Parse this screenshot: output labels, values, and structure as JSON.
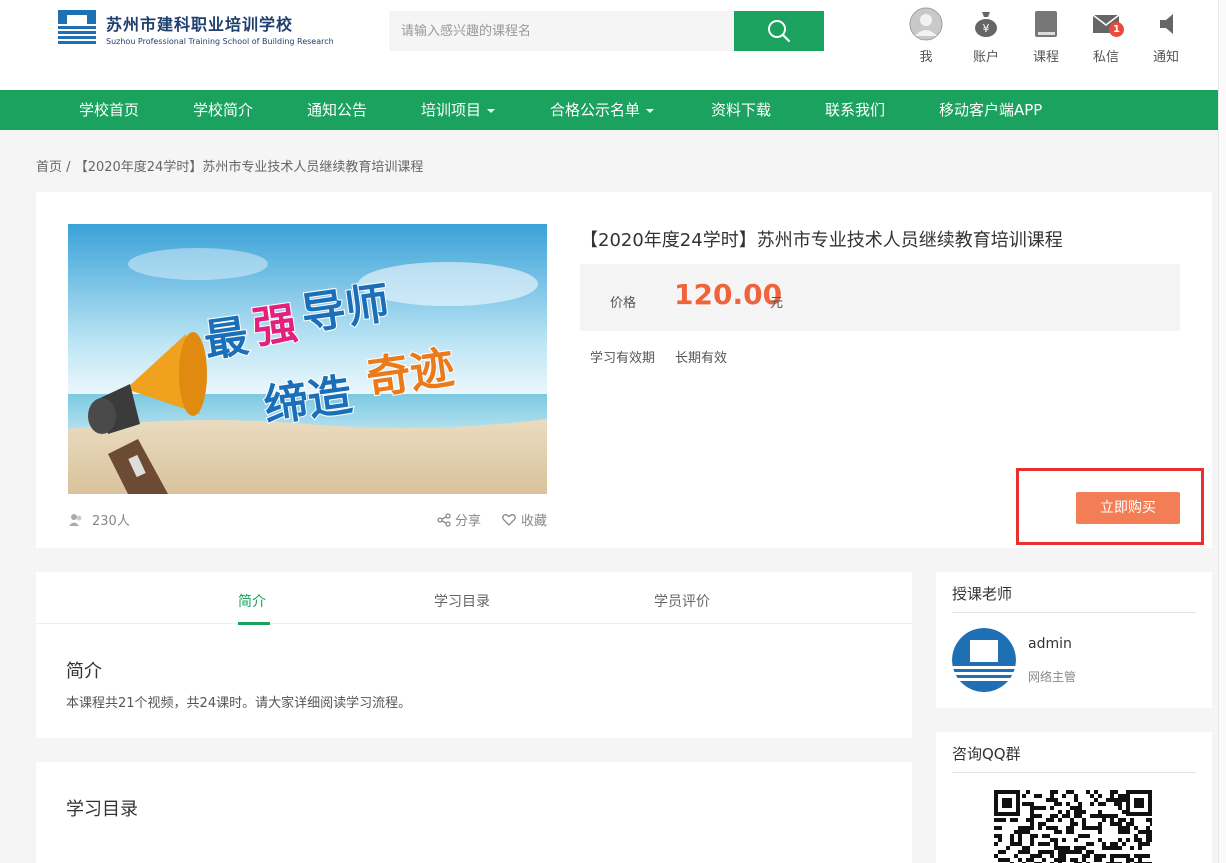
{
  "brand": {
    "name_cn": "苏州市建科职业培训学校",
    "name_en": "Suzhou Professional Training School of Building Research"
  },
  "search": {
    "placeholder": "请输入感兴趣的课程名"
  },
  "top_icons": [
    {
      "label": "我",
      "icon": "user-avatar-icon"
    },
    {
      "label": "账户",
      "icon": "money-bag-icon"
    },
    {
      "label": "课程",
      "icon": "book-icon"
    },
    {
      "label": "私信",
      "icon": "mail-icon",
      "badge": "1"
    },
    {
      "label": "通知",
      "icon": "speaker-icon"
    }
  ],
  "nav": [
    {
      "label": "学校首页"
    },
    {
      "label": "学校简介"
    },
    {
      "label": "通知公告"
    },
    {
      "label": "培训项目",
      "dropdown": true
    },
    {
      "label": "合格公示名单",
      "dropdown": true
    },
    {
      "label": "资料下载"
    },
    {
      "label": "联系我们"
    },
    {
      "label": "移动客户端APP"
    }
  ],
  "breadcrumb": {
    "home": "首页",
    "separator": "/",
    "current": "【2020年度24学时】苏州市专业技术人员继续教育培训课程"
  },
  "course": {
    "banner_line1_a": "最",
    "banner_line1_b": "强",
    "banner_line1_c": "导师",
    "banner_line2_a": "缔造",
    "banner_line2_b": "奇迹",
    "students": "230人",
    "share": "分享",
    "favorite": "收藏",
    "title": "【2020年度24学时】苏州市专业技术人员继续教育培训课程",
    "price_label": "价格",
    "price": "120.00",
    "price_unit": "元",
    "validity_label": "学习有效期",
    "validity_value": "长期有效",
    "buy_label": "立即购买"
  },
  "tabs": [
    {
      "label": "简介",
      "active": true
    },
    {
      "label": "学习目录",
      "active": false
    },
    {
      "label": "学员评价",
      "active": false
    }
  ],
  "intro": {
    "title": "简介",
    "text": "本课程共21个视频，共24课时。请大家详细阅读学习流程。"
  },
  "catalog": {
    "title": "学习目录"
  },
  "teacher": {
    "title": "授课老师",
    "name": "admin",
    "role": "网络主管"
  },
  "qq": {
    "title": "咨询QQ群"
  },
  "colors": {
    "brand_green": "#1aa25e",
    "price_orange": "#f0643c",
    "buy_button": "#f37e55",
    "highlight_red": "#e8312f",
    "logo_blue": "#1f6fb5"
  }
}
